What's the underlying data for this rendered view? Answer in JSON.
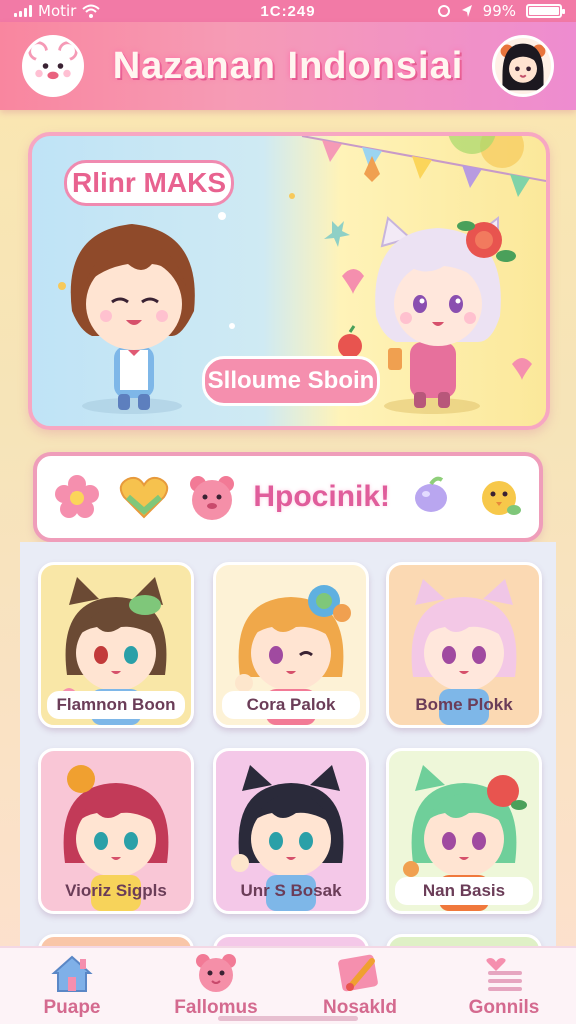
{
  "status_bar": {
    "carrier": "Motir",
    "time": "1C:249",
    "battery_label": "99%",
    "battery_level": 0.99
  },
  "header": {
    "title": "Nazanan Indonsiai",
    "left_avatar_icon": "bear-avatar-icon",
    "right_avatar_icon": "girl-profile-avatar-icon"
  },
  "hero": {
    "bubble_top": "Rlinr MAKS",
    "bubble_bottom": "Slloume Sboin"
  },
  "categories": {
    "label": "Hpocinik!",
    "icons": [
      "flower-icon",
      "heart-icon",
      "bear-face-icon",
      "candy-icon",
      "chick-icon"
    ]
  },
  "characters": [
    {
      "name": "Flamnon Boon",
      "bg": "#f9e7a7"
    },
    {
      "name": "Cora Palok",
      "bg": "#fdf2d6"
    },
    {
      "name": "Bome Plokk",
      "bg": "#fbd9b3"
    },
    {
      "name": "Vioriz Sigpls",
      "bg": "#f9c6d6"
    },
    {
      "name": "Unr S Bosak",
      "bg": "#f4c8e8"
    },
    {
      "name": "Nan Basis",
      "bg": "#eef7d9"
    }
  ],
  "bottom_nav": [
    {
      "label": "Puape",
      "icon": "home-icon"
    },
    {
      "label": "Fallomus",
      "icon": "bear-face-icon"
    },
    {
      "label": "Nosakld",
      "icon": "brush-icon"
    },
    {
      "label": "Gonnils",
      "icon": "menu-heart-icon"
    }
  ],
  "colors": {
    "accent": "#f27aa6",
    "title_glow": "#ff6fa8",
    "card_border": "#ef9dba"
  }
}
